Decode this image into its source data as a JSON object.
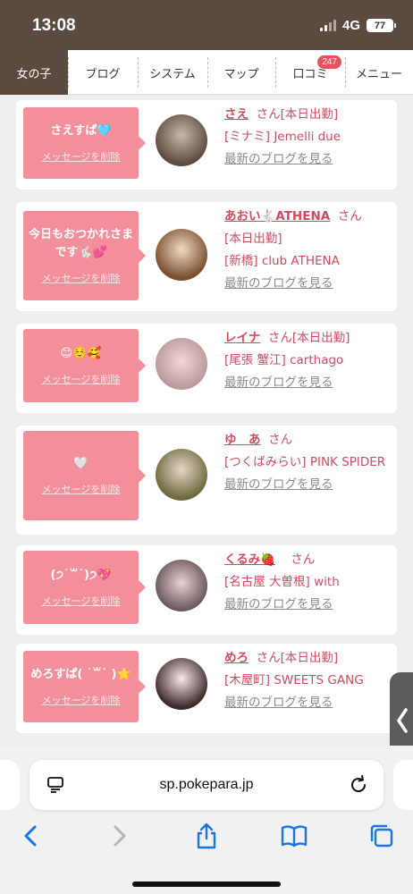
{
  "status": {
    "time": "13:08",
    "network": "4G",
    "battery": "77"
  },
  "nav": {
    "tabs": [
      {
        "label": "女の子",
        "active": true
      },
      {
        "label": "ブログ"
      },
      {
        "label": "システム"
      },
      {
        "label": "マップ"
      },
      {
        "label": "口コミ",
        "badge": "247"
      },
      {
        "label": "メニュー"
      }
    ]
  },
  "cards": [
    {
      "message": "さえすぱ🩵",
      "delete_label": "メッセージを削除",
      "name": "さえ",
      "suffix": "さん[本日出勤]",
      "shop": "[ミナミ] Jemelli due",
      "blog_link": "最新のブログを見る"
    },
    {
      "message": "今日もおつかれさまです🐇💕",
      "delete_label": "メッセージを削除",
      "name": "あおい🐇ATHENA",
      "suffix": "さん",
      "shop": "[本日出勤]",
      "shop2": "[新橋] club ATHENA",
      "blog_link": "最新のブログを見る"
    },
    {
      "message": "😊☺️🥰",
      "delete_label": "メッセージを削除",
      "name": "レイナ",
      "suffix": "さん[本日出勤]",
      "shop": "[尾張 蟹江] carthago",
      "blog_link": "最新のブログを見る"
    },
    {
      "message": "🤍",
      "delete_label": "メッセージを削除",
      "name": "ゆ　あ",
      "suffix": "さん",
      "shop": "[つくばみらい] PINK SPIDER",
      "blog_link": "最新のブログを見る"
    },
    {
      "message": "(੭˙꒳˙)੭💖",
      "delete_label": "メッセージを削除",
      "name": "くるみ🍓",
      "suffix": "さん",
      "shop": "[名古屋 大曽根] with",
      "blog_link": "最新のブログを見る"
    },
    {
      "message": "めろすぱ( ˙꒳˙ )⭐️",
      "delete_label": "メッセージを削除",
      "name": "めろ",
      "suffix": "さん[本日出勤]",
      "shop": "[木屋町] SWEETS GANG",
      "blog_link": "最新のブログを見る"
    }
  ],
  "browser": {
    "url": "sp.pokepara.jp"
  },
  "colors": {
    "brand_brown": "#5a4a40",
    "bubble_pink": "#f38f9b",
    "link_pink": "#d14b5f",
    "ios_blue": "#1a73e8"
  }
}
